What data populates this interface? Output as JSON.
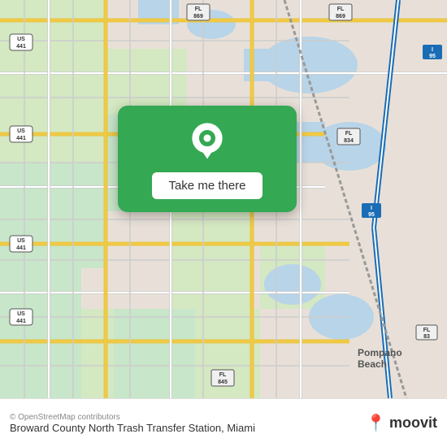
{
  "map": {
    "attribution": "© OpenStreetMap contributors",
    "location_name": "Broward County North Trash Transfer Station, Miami",
    "button_label": "Take me there",
    "moovit_text": "moovit"
  },
  "shields": {
    "us441_labels": [
      "US",
      "441"
    ],
    "fl869_label": [
      "FL",
      "869"
    ],
    "fl834_label": [
      "FL",
      "834"
    ],
    "fl845_label": [
      "FL",
      "845"
    ],
    "i95_label": "I 95",
    "fl83_label": [
      "FL",
      "83"
    ]
  },
  "footer": {
    "city_label": "Pompano Bea..."
  }
}
